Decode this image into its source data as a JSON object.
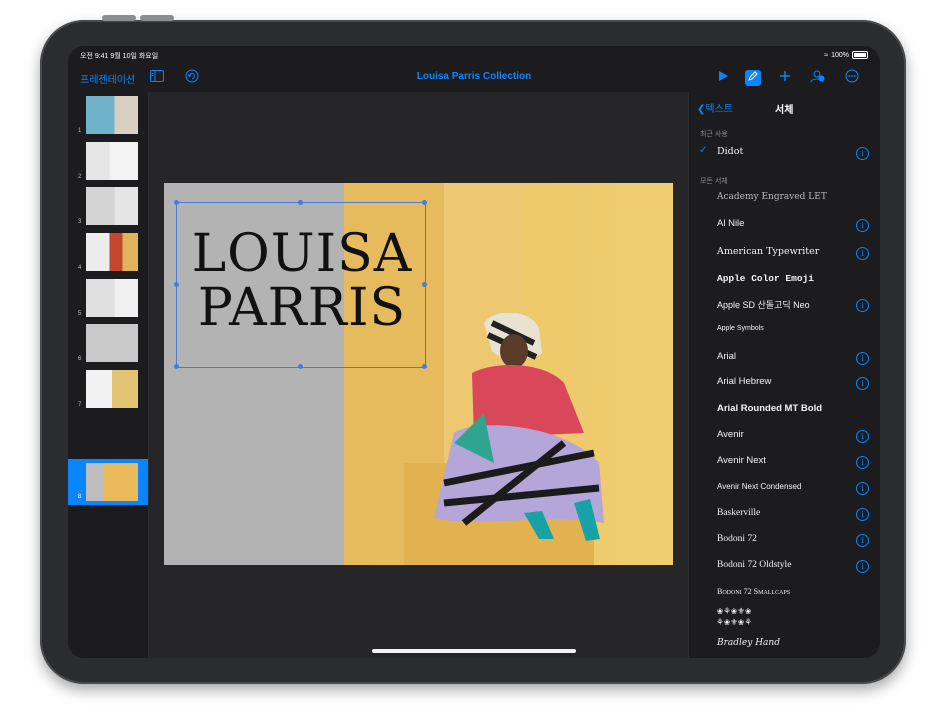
{
  "status": {
    "time": "오전 9:41  9월 10일 화요일",
    "battery": "100%"
  },
  "toolbar": {
    "back_label": "프레젠테이션",
    "title": "Louisa Parris Collection",
    "icons": [
      "sidebar-icon",
      "undo-icon",
      "play-icon",
      "format-brush-icon",
      "add-icon",
      "collaborate-icon",
      "more-icon"
    ]
  },
  "slides": [
    {
      "num": "1"
    },
    {
      "num": "2"
    },
    {
      "num": "3"
    },
    {
      "num": "4"
    },
    {
      "num": "5"
    },
    {
      "num": "6"
    },
    {
      "num": "7"
    },
    {
      "num": "8"
    }
  ],
  "slide": {
    "title_line1": "LOUISA",
    "title_line2": "PARRIS"
  },
  "panel": {
    "back_label": "텍스트",
    "title": "서체",
    "recent_label": "최근 사용",
    "recent_font": "Didot",
    "all_label": "모든 서체",
    "fonts": [
      "Academy Engraved LET",
      "Al Nile",
      "American Typewriter",
      "Apple  Color  Emoji",
      "Apple SD 산돌고딕 Neo",
      "Apple  Symbols",
      "Arial",
      "Arial Hebrew",
      "Arial Rounded MT Bold",
      "Avenir",
      "Avenir Next",
      "Avenir Next Condensed",
      "Baskerville",
      "Bodoni 72",
      "Bodoni 72 Oldstyle",
      "Bodoni 72 Smallcaps",
      "Bradley Hand"
    ]
  },
  "colors": {
    "accent": "#0a84ff",
    "background": "#1c1c1e"
  }
}
